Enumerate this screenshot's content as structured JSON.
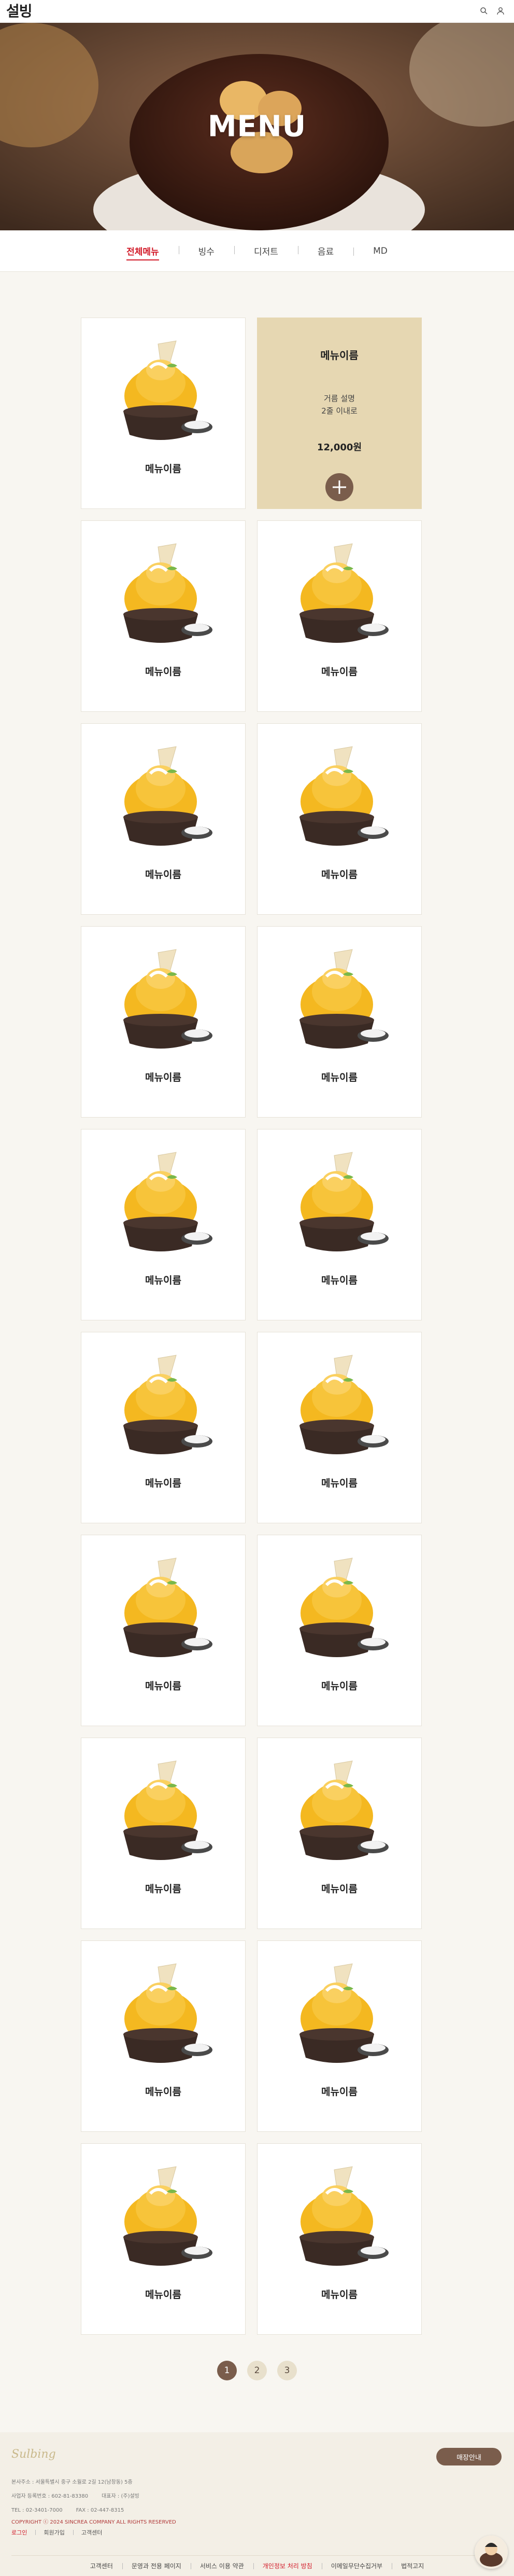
{
  "header": {
    "logo": "설빙",
    "search_icon": "search-icon",
    "user_icon": "user-icon"
  },
  "hero": {
    "title": "MENU"
  },
  "tabs": [
    {
      "label": "전체메뉴",
      "active": true
    },
    {
      "label": "빙수"
    },
    {
      "label": "디저트"
    },
    {
      "label": "음료"
    },
    {
      "label": "MD"
    }
  ],
  "featured": {
    "name": "메뉴이름",
    "desc_line1": "거름 설명",
    "desc_line2": "2줄 이내로",
    "price": "12,000원"
  },
  "menu_items": [
    "메뉴이름",
    "메뉴이름",
    "메뉴이름",
    "메뉴이름",
    "메뉴이름",
    "메뉴이름",
    "메뉴이름",
    "메뉴이름",
    "메뉴이름",
    "메뉴이름",
    "메뉴이름",
    "메뉴이름",
    "메뉴이름",
    "메뉴이름",
    "메뉴이름",
    "메뉴이름",
    "메뉴이름",
    "메뉴이름",
    "메뉴이름"
  ],
  "pagination": [
    "1",
    "2",
    "3"
  ],
  "footer": {
    "logo": "Sulbing",
    "store_button": "매장안내",
    "addr": "본사주소 : 서울특별시 중구 소월로 2길 12(남창동) 5층",
    "biz": "사업자 등록번호 : 602-81-83380",
    "ceo": "대표자 : (주)설빙",
    "tel": "TEL : 02-3401-7000",
    "fax": "FAX : 02-447-8315",
    "copyright": "COPYRIGHT ⓒ 2024 SINCREA COMPANY ALL RIGHTS RESERVED",
    "links_top": [
      "로그인",
      "회원가입",
      "고객센터"
    ],
    "links_bottom": [
      "고객센터",
      "문영과 전용 페이지",
      "서비스 이용 약관",
      "개인정보 처리 방침",
      "이메일무단수집거부",
      "법적고지"
    ]
  },
  "colors": {
    "accent": "#d21a28",
    "brand": "#7a5d4c",
    "cream": "#e6d7b2"
  }
}
